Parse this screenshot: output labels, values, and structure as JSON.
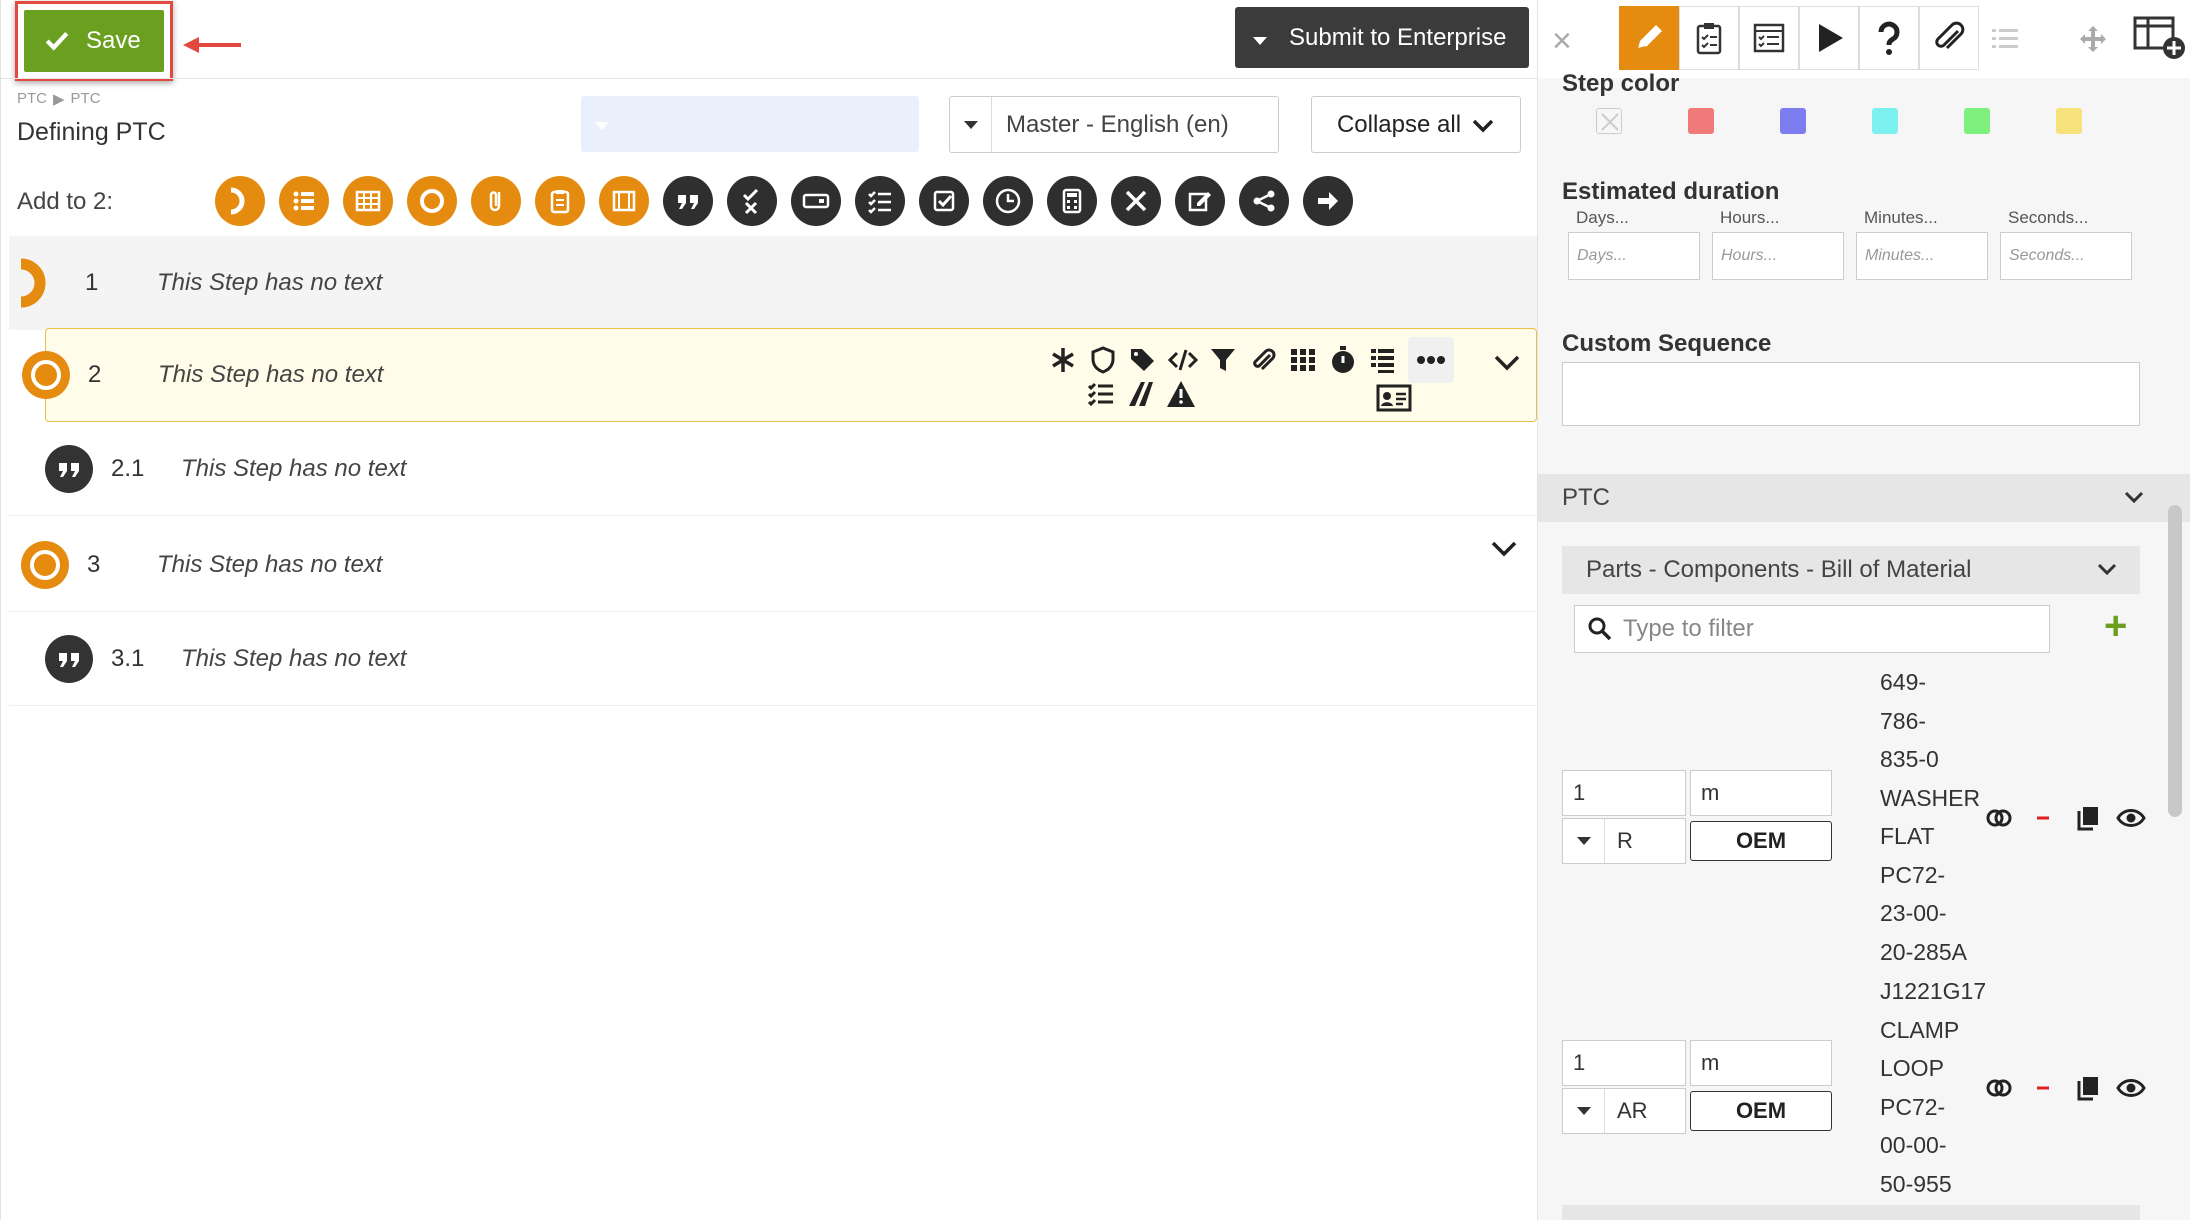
{
  "toolbar": {
    "save_label": "Save",
    "submit_label": "Submit to Enterprise"
  },
  "header": {
    "breadcrumb": [
      "PTC",
      "PTC"
    ],
    "title": "Defining PTC",
    "language": "Master - English (en)",
    "collapse_label": "Collapse all",
    "add_to_label": "Add to 2:"
  },
  "steps": [
    {
      "num": "1",
      "text": "This Step has no text",
      "icon": "half-ring-icon"
    },
    {
      "num": "2",
      "text": "This Step has no text",
      "icon": "ring-icon"
    },
    {
      "num": "2.1",
      "text": "This Step has no text",
      "icon": "quote-icon"
    },
    {
      "num": "3",
      "text": "This Step has no text",
      "icon": "ring-icon"
    },
    {
      "num": "3.1",
      "text": "This Step has no text",
      "icon": "quote-icon"
    }
  ],
  "right_panel": {
    "step_color_label": "Step color",
    "swatches": [
      "#e8e8e8",
      "#f07a7a",
      "#7d7df0",
      "#7df0f0",
      "#7df07d",
      "#f7e17a"
    ],
    "duration_label": "Estimated duration",
    "duration_fields": [
      {
        "label": "Days...",
        "placeholder": "Days..."
      },
      {
        "label": "Hours...",
        "placeholder": "Hours..."
      },
      {
        "label": "Minutes...",
        "placeholder": "Minutes..."
      },
      {
        "label": "Seconds...",
        "placeholder": "Seconds..."
      }
    ],
    "custom_sequence_label": "Custom Sequence",
    "ptc_label": "PTC",
    "bom_label": "Parts - Components - Bill of Material",
    "filter_placeholder": "Type to filter",
    "parts": [
      {
        "qty": "1",
        "unit": "m",
        "type": "R",
        "oem": "OEM",
        "text": "649-\n786-\n835-0\nWASHER\nFLAT\nPC72-\n23-00-\n20-285A"
      },
      {
        "qty": "1",
        "unit": "m",
        "type": "AR",
        "oem": "OEM",
        "text": "J1221G17\nCLAMP\nLOOP\nPC72-\n00-00-\n50-955"
      }
    ]
  },
  "colors": {
    "accent": "#e58b0f",
    "save_green": "#6a9f1f",
    "dark": "#3b3b3b",
    "highlight_red": "#e24a3f"
  }
}
